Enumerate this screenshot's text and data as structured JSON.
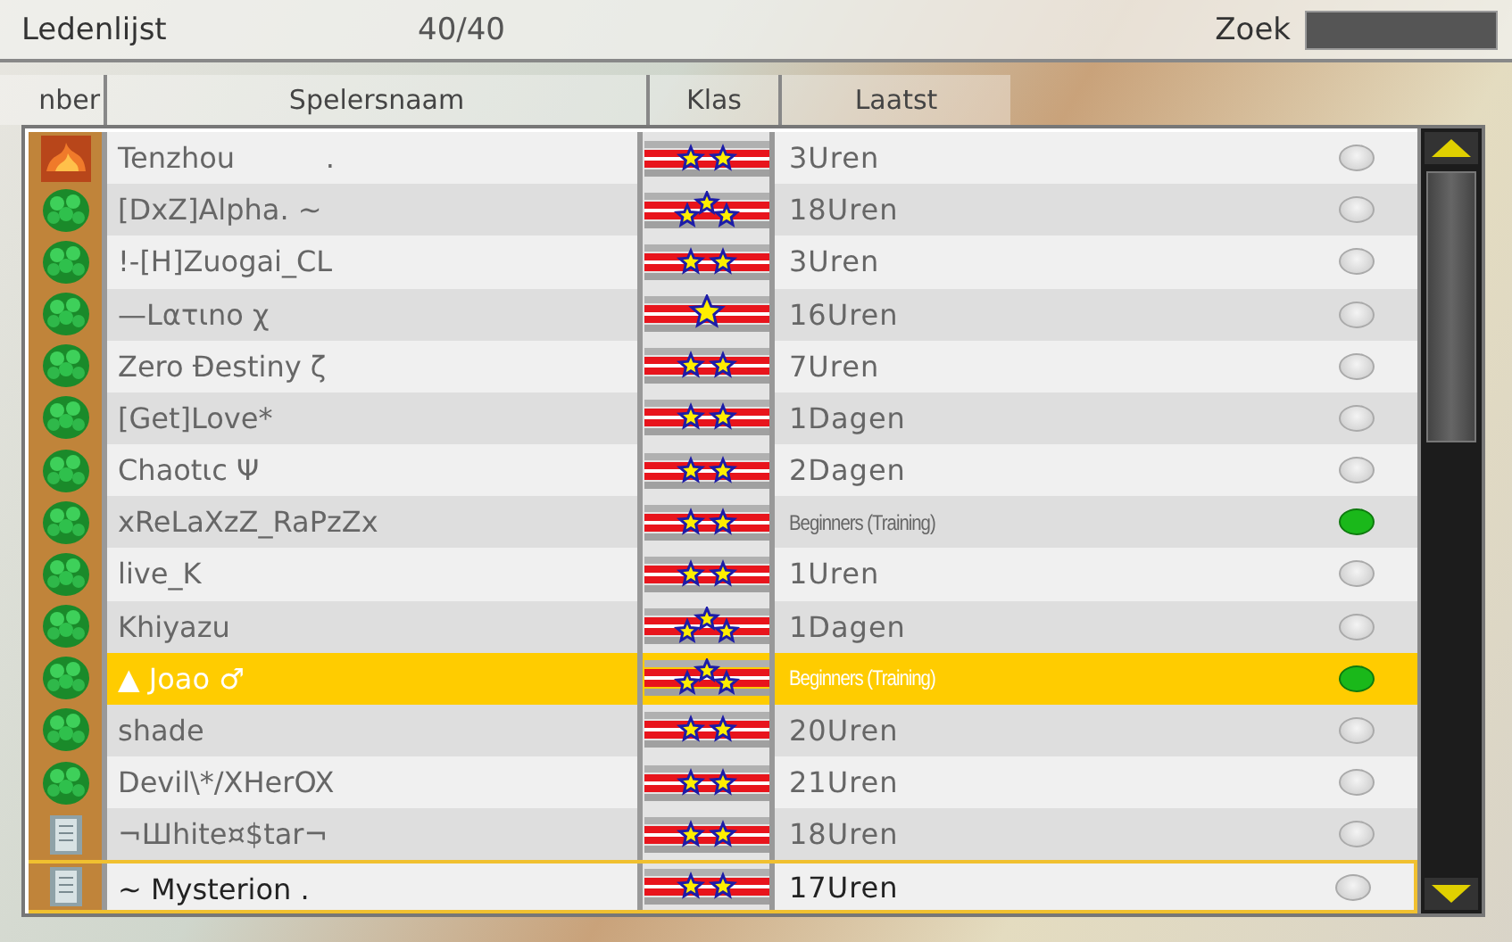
{
  "header": {
    "title": "Ledenlijst",
    "count": "40/40",
    "search_label": "Zoek"
  },
  "columns": [
    "nber",
    "Spelersnaam",
    "Klas",
    "Laatst"
  ],
  "rows": [
    {
      "kind": "flame",
      "name": "Tenzhou          .",
      "badge": {
        "kind": "two-star"
      },
      "last": {
        "text": "3Uren",
        "kind": "time"
      },
      "online": false,
      "selected": false,
      "focused": false
    },
    {
      "kind": "shell",
      "name": "[DxZ]Alpha. ~",
      "badge": {
        "kind": "three-star"
      },
      "last": {
        "text": "18Uren",
        "kind": "time"
      },
      "online": false,
      "selected": false,
      "focused": false
    },
    {
      "kind": "shell",
      "name": "!-[H]Zuogai_CL",
      "badge": {
        "kind": "two-star"
      },
      "last": {
        "text": "3Uren",
        "kind": "time"
      },
      "online": false,
      "selected": false,
      "focused": false
    },
    {
      "kind": "shell",
      "name": "—Lατιno χ",
      "badge": {
        "kind": "one-star"
      },
      "last": {
        "text": "16Uren",
        "kind": "time"
      },
      "online": false,
      "selected": false,
      "focused": false
    },
    {
      "kind": "shell",
      "name": "Zero Ðestiny ζ",
      "badge": {
        "kind": "two-star"
      },
      "last": {
        "text": "7Uren",
        "kind": "time"
      },
      "online": false,
      "selected": false,
      "focused": false
    },
    {
      "kind": "shell",
      "name": "[Get]Love*",
      "badge": {
        "kind": "two-star"
      },
      "last": {
        "text": "1Dagen",
        "kind": "time"
      },
      "online": false,
      "selected": false,
      "focused": false
    },
    {
      "kind": "shell",
      "name": "Chaotιc Ψ",
      "badge": {
        "kind": "two-star"
      },
      "last": {
        "text": "2Dagen",
        "kind": "time"
      },
      "online": false,
      "selected": false,
      "focused": false
    },
    {
      "kind": "shell",
      "name": "xReLaXzZ_RaPzZx",
      "badge": {
        "kind": "two-star"
      },
      "last": {
        "text": "Beginners (Training)",
        "kind": "channel"
      },
      "online": true,
      "selected": false,
      "focused": false
    },
    {
      "kind": "shell",
      "name": "live_K",
      "badge": {
        "kind": "two-star"
      },
      "last": {
        "text": "1Uren",
        "kind": "time"
      },
      "online": false,
      "selected": false,
      "focused": false
    },
    {
      "kind": "shell",
      "name": "Khiyazu",
      "badge": {
        "kind": "three-star"
      },
      "last": {
        "text": "1Dagen",
        "kind": "time"
      },
      "online": false,
      "selected": false,
      "focused": false
    },
    {
      "kind": "shell",
      "name": "▲ Joao ♂",
      "badge": {
        "kind": "three-star"
      },
      "last": {
        "text": "Beginners (Training)",
        "kind": "channel"
      },
      "online": true,
      "selected": true,
      "focused": false
    },
    {
      "kind": "shell",
      "name": "shade",
      "badge": {
        "kind": "two-star"
      },
      "last": {
        "text": "20Uren",
        "kind": "time"
      },
      "online": false,
      "selected": false,
      "focused": false
    },
    {
      "kind": "shell",
      "name": "Devil\\*/XHerOX",
      "badge": {
        "kind": "two-star"
      },
      "last": {
        "text": "21Uren",
        "kind": "time"
      },
      "online": false,
      "selected": false,
      "focused": false
    },
    {
      "kind": "scroll",
      "name": "¬Шhite¤$tar¬",
      "badge": {
        "kind": "two-star"
      },
      "last": {
        "text": "18Uren",
        "kind": "time"
      },
      "online": false,
      "selected": false,
      "focused": false
    },
    {
      "kind": "scroll",
      "name": "~ Mysterion .",
      "badge": {
        "kind": "two-star"
      },
      "last": {
        "text": "17Uren",
        "kind": "time"
      },
      "online": false,
      "selected": false,
      "focused": true
    }
  ]
}
